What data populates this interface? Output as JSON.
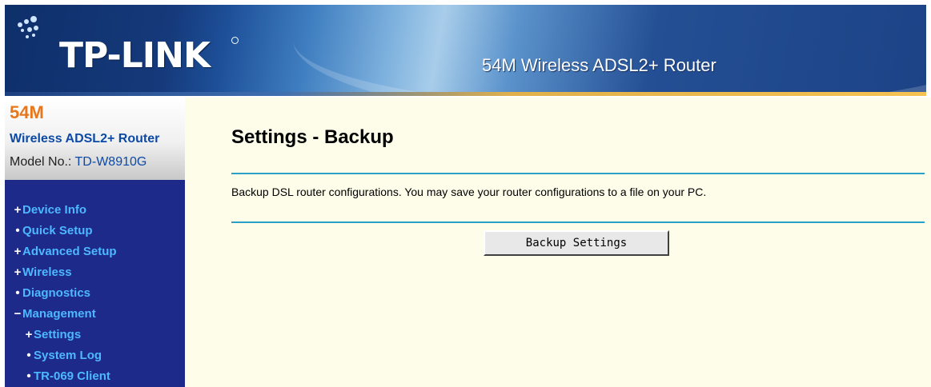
{
  "header": {
    "logo": "TP-LINK",
    "title": "54M Wireless ADSL2+ Router"
  },
  "sidebar": {
    "model_size": "54M",
    "model_name": "Wireless ADSL2+ Router",
    "model_no_label": "Model No.: ",
    "model_no_value": "TD-W8910G",
    "nav": [
      {
        "label": "Device Info",
        "bullet": "+"
      },
      {
        "label": "Quick Setup",
        "bullet": "•"
      },
      {
        "label": "Advanced Setup",
        "bullet": "+"
      },
      {
        "label": "Wireless",
        "bullet": "+"
      },
      {
        "label": "Diagnostics",
        "bullet": "•"
      },
      {
        "label": "Management",
        "bullet": "−"
      },
      {
        "label": "Settings",
        "bullet": "+"
      },
      {
        "label": "System Log",
        "bullet": "•"
      },
      {
        "label": "TR-069 Client",
        "bullet": "•"
      }
    ]
  },
  "main": {
    "title": "Settings - Backup",
    "description": "Backup DSL router configurations. You may save your router configurations to a file on your PC.",
    "button_label": "Backup Settings"
  },
  "colors": {
    "sidebar_bg": "#1d2a8a",
    "nav_text": "#4db8ff",
    "main_bg": "#fdfde9",
    "rule": "#2aa0c8",
    "accent_orange": "#e8761a"
  }
}
